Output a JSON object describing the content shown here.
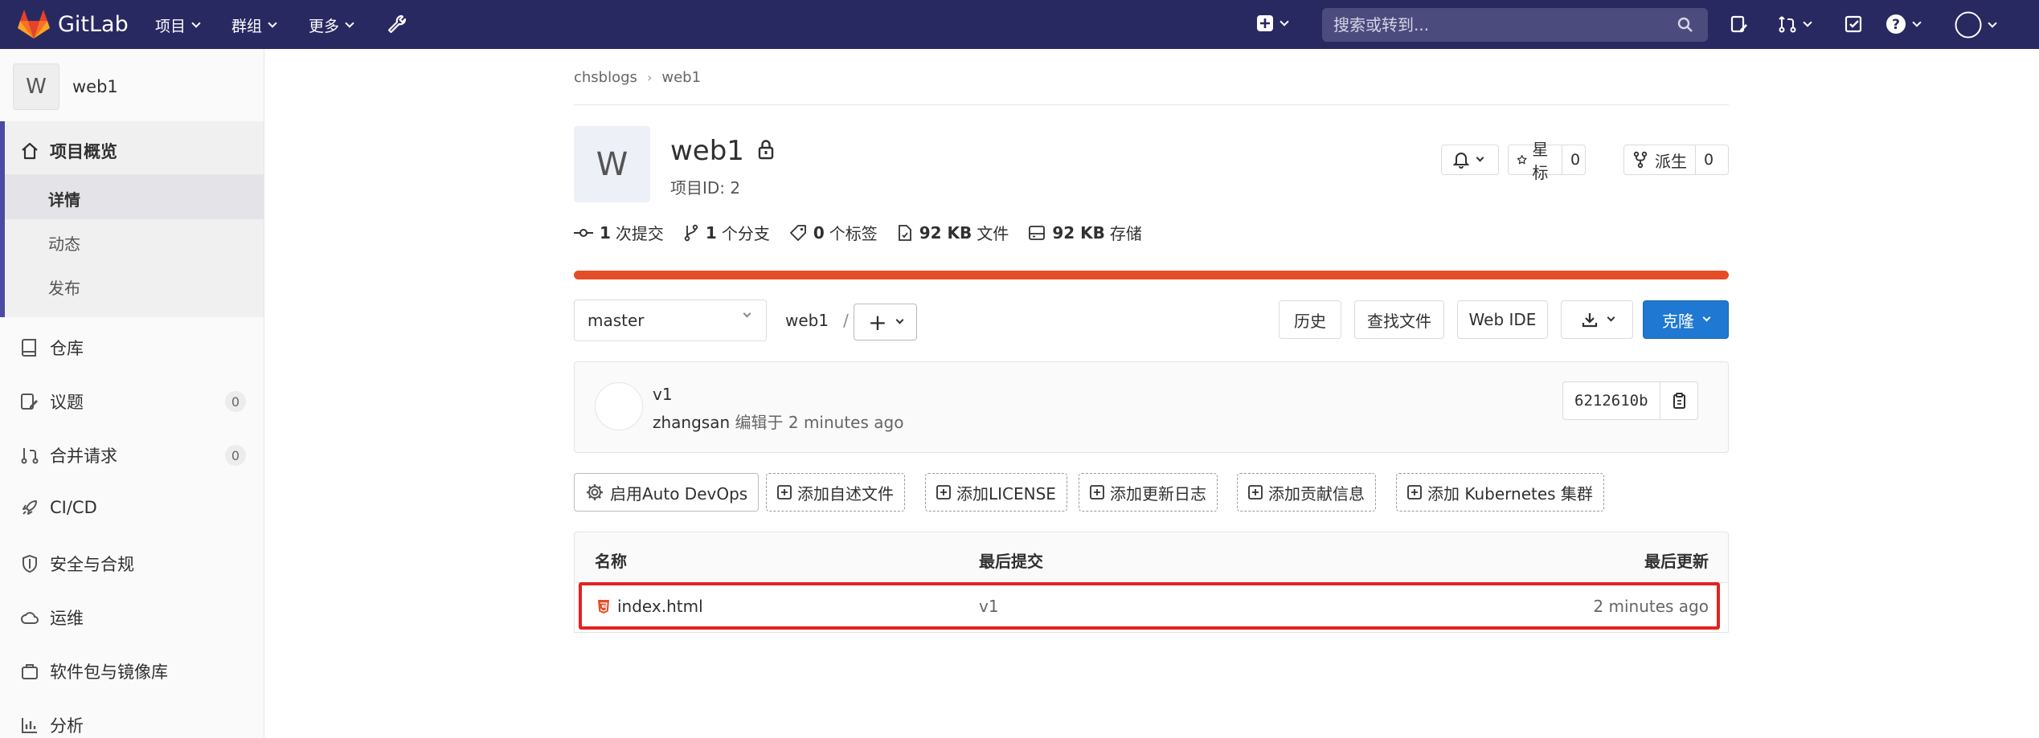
{
  "topnav": {
    "logo_text": "GitLab",
    "items": [
      {
        "label": "项目"
      },
      {
        "label": "群组"
      },
      {
        "label": "更多"
      }
    ],
    "search_placeholder": "搜索或转到...",
    "brand_color": "#292961"
  },
  "sidebar": {
    "avatar_letter": "W",
    "project_name": "web1",
    "overview_label": "项目概览",
    "sub_items": [
      "详情",
      "动态",
      "发布"
    ],
    "items": [
      {
        "label": "仓库",
        "icon": "book-icon"
      },
      {
        "label": "议题",
        "icon": "issues-icon",
        "badge": "0"
      },
      {
        "label": "合并请求",
        "icon": "merge-request-icon",
        "badge": "0"
      },
      {
        "label": "CI/CD",
        "icon": "rocket-icon"
      },
      {
        "label": "安全与合规",
        "icon": "shield-icon"
      },
      {
        "label": "运维",
        "icon": "cloud-icon"
      },
      {
        "label": "软件包与镜像库",
        "icon": "package-icon"
      },
      {
        "label": "分析",
        "icon": "chart-icon"
      }
    ]
  },
  "breadcrumb": [
    "chsblogs",
    "web1"
  ],
  "project": {
    "avatar_letter": "W",
    "name": "web1",
    "id_label": "项目ID: 2",
    "star_label": "星标",
    "star_count": "0",
    "fork_label": "派生",
    "fork_count": "0"
  },
  "stats": [
    {
      "value": "1",
      "label": "次提交"
    },
    {
      "value": "1",
      "label": "个分支"
    },
    {
      "value": "0",
      "label": "个标签"
    },
    {
      "value": "92 KB",
      "label": "文件"
    },
    {
      "value": "92 KB",
      "label": "存储"
    }
  ],
  "language_bar_color": "#e44d26",
  "repo": {
    "branch": "master",
    "path": "web1",
    "slash": "/",
    "plus": "+",
    "history_label": "历史",
    "find_file_label": "查找文件",
    "web_ide_label": "Web IDE",
    "clone_label": "克隆"
  },
  "last_commit": {
    "message": "v1",
    "author": "zhangsan",
    "meta": "编辑于 2 minutes ago",
    "sha": "6212610b"
  },
  "actions": [
    "启用Auto DevOps",
    "添加自述文件",
    "添加LICENSE",
    "添加更新日志",
    "添加贡献信息",
    "添加 Kubernetes 集群"
  ],
  "file_table": {
    "headers": [
      "名称",
      "最后提交",
      "最后更新"
    ],
    "rows": [
      {
        "name": "index.html",
        "commit": "v1",
        "updated": "2 minutes ago"
      }
    ]
  },
  "highlight_color": "#e32222"
}
